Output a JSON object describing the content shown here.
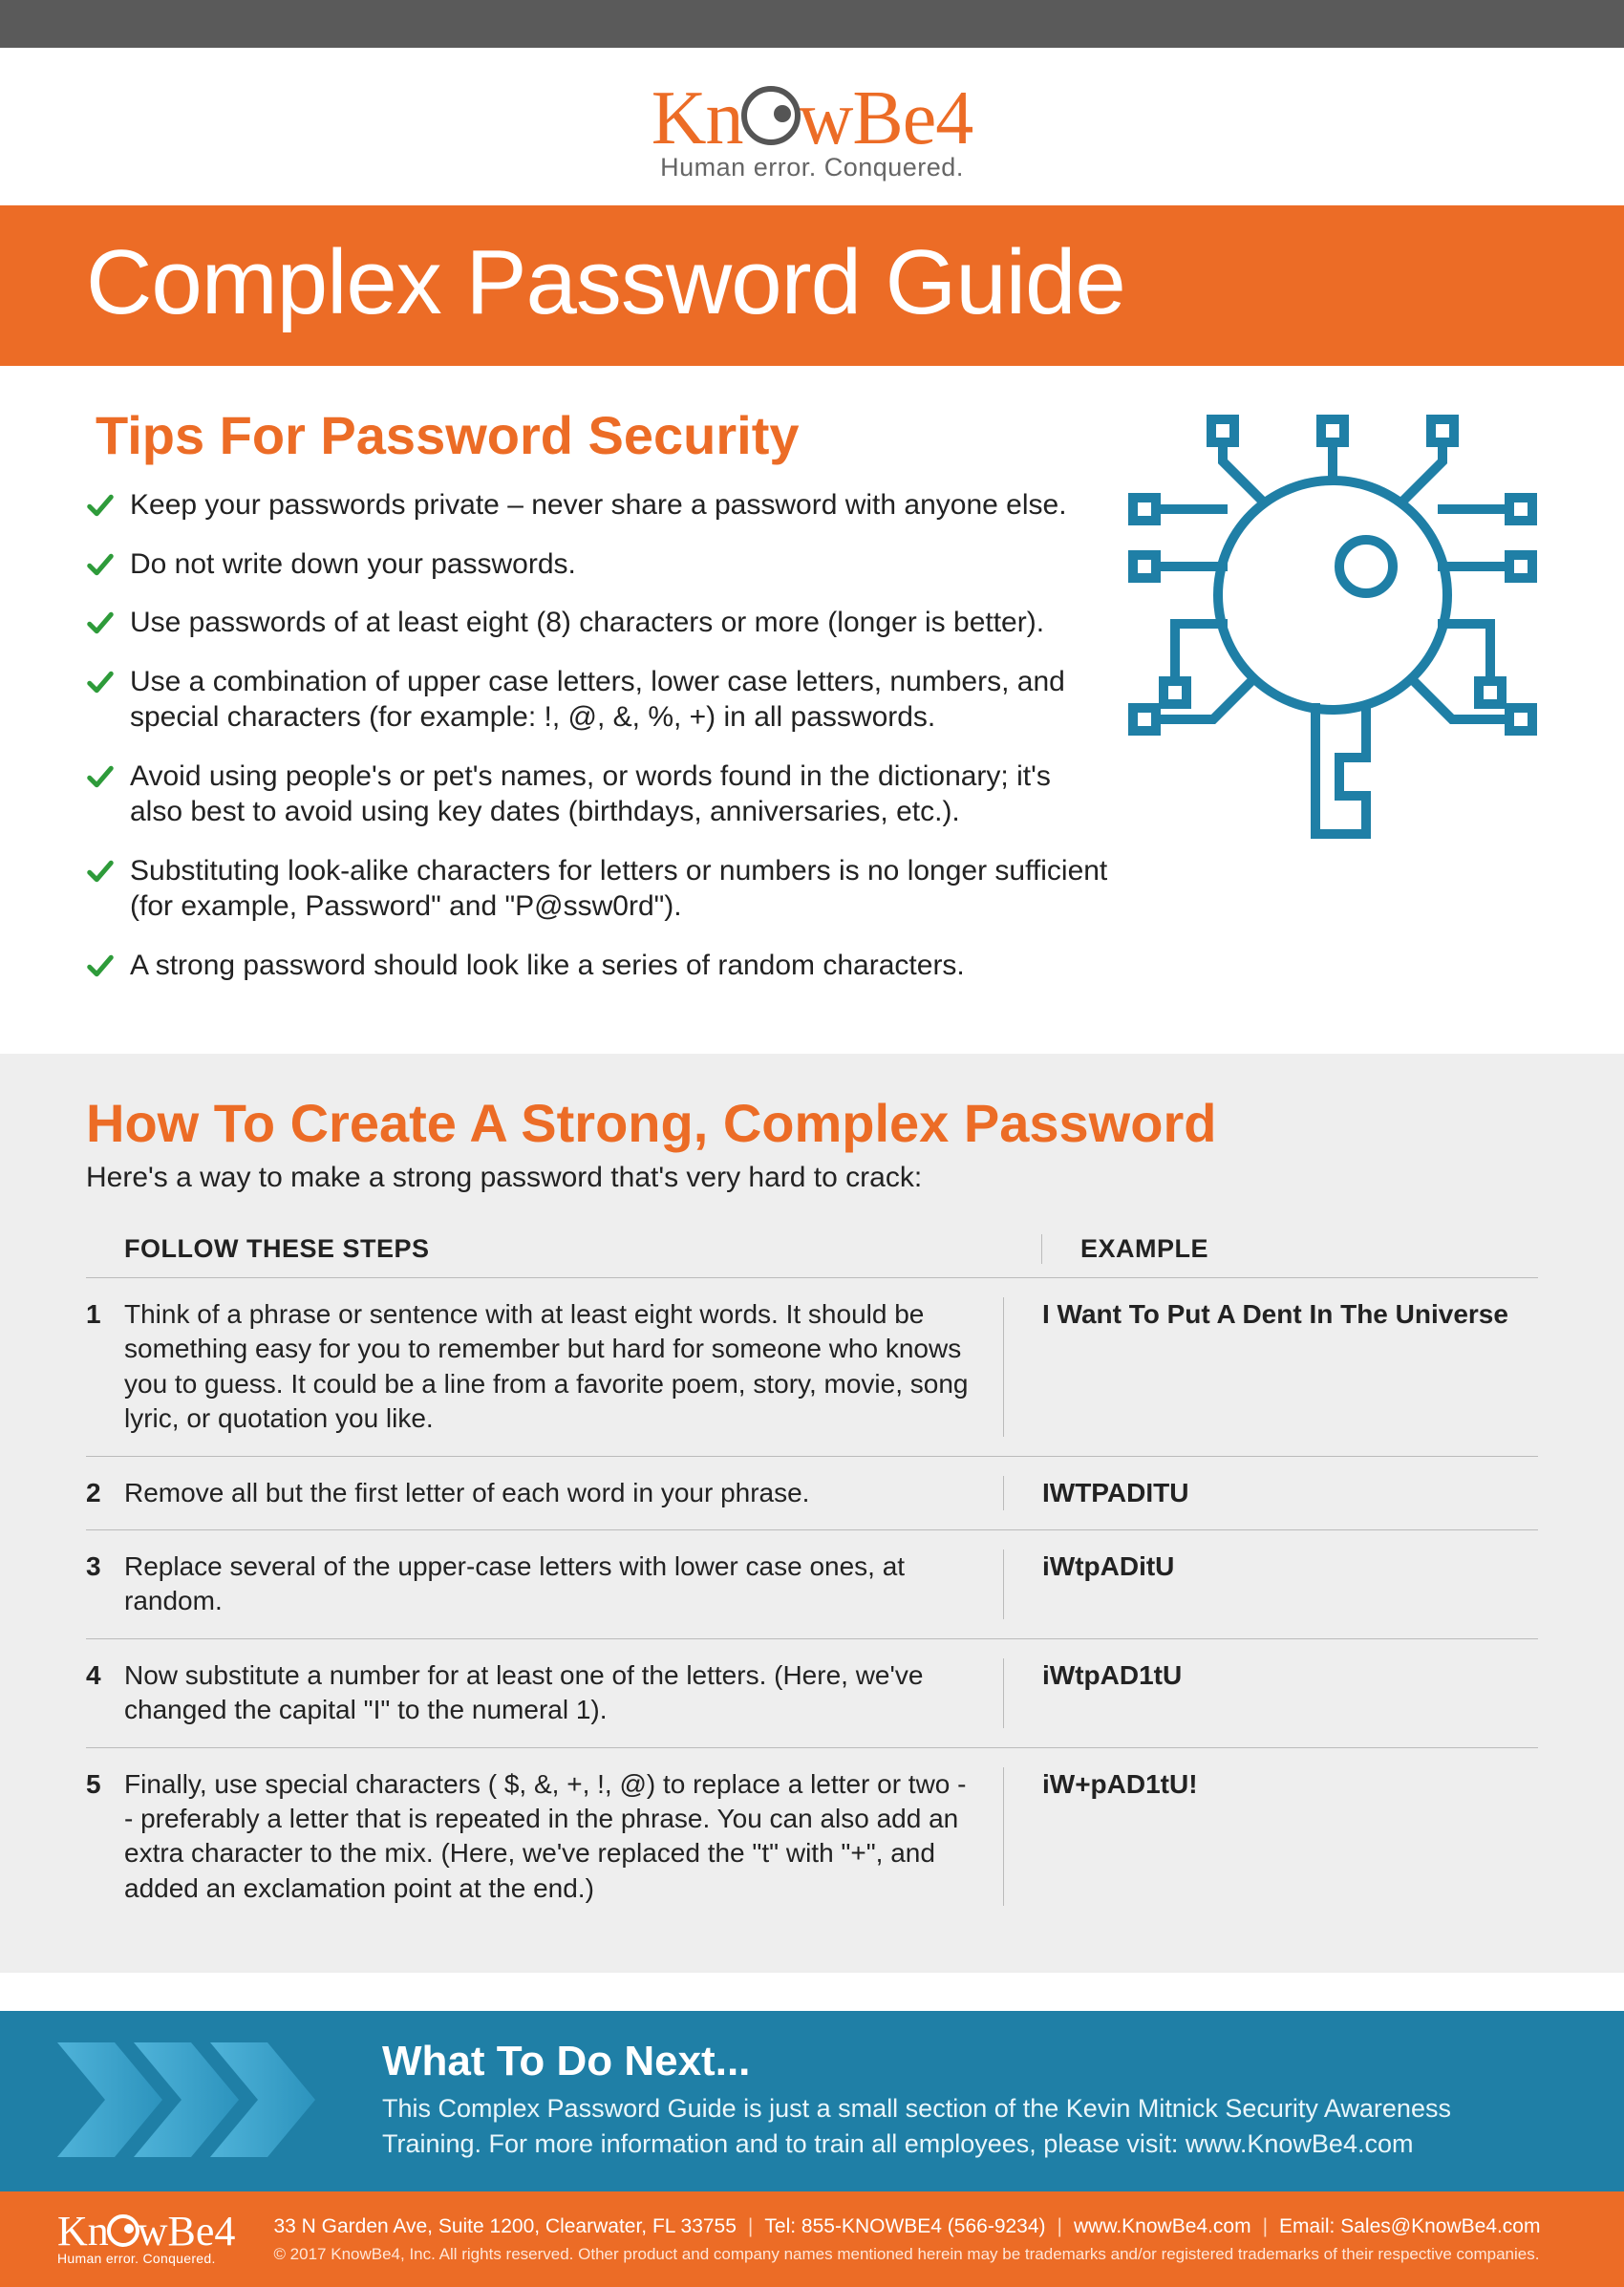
{
  "brand": {
    "name_part1": "Kn",
    "name_part2": "wBe4",
    "tagline": "Human error. Conquered."
  },
  "hero": {
    "title": "Complex Password Guide"
  },
  "tips": {
    "title": "Tips For Password Security",
    "items": [
      "Keep your passwords private – never share a password with anyone else.",
      "Do not write down your passwords.",
      "Use passwords of at least eight (8) characters or more (longer is better).",
      "Use a combination of upper case letters, lower case letters, numbers, and special characters (for example: !, @, &, %, +) in all passwords.",
      "Avoid using people's or pet's names, or words found in the dictionary; it's also best to avoid using key dates (birthdays, anniversaries, etc.).",
      "Substituting look-alike characters for letters or numbers is no longer sufficient (for example, Password\" and \"P@ssw0rd\").",
      "A strong password should look like a series of random characters."
    ]
  },
  "howto": {
    "title": "How To Create A Strong, Complex Password",
    "subtitle": "Here's a way to make a strong password that's very hard to crack:",
    "head_steps": "FOLLOW THESE STEPS",
    "head_example": "EXAMPLE",
    "steps": [
      {
        "n": "1",
        "text": "Think of a phrase or sentence with at least eight words. It should be something easy for you to remember but hard for someone who knows you to guess. It could be a line from a favorite poem, story, movie, song lyric, or quotation you like.",
        "example": "I Want To Put A Dent In The Universe"
      },
      {
        "n": "2",
        "text": "Remove all but the first letter of each word in your phrase.",
        "example": "IWTPADITU"
      },
      {
        "n": "3",
        "text": "Replace several of the upper-case letters with lower case ones, at random.",
        "example": "iWtpADitU"
      },
      {
        "n": "4",
        "text": "Now substitute a number for at least one of the letters. (Here, we've changed the capital \"I\" to the numeral 1).",
        "example": "iWtpAD1tU"
      },
      {
        "n": "5",
        "text": "Finally, use special characters ( $, &, +, !, @) to replace a letter or two -- preferably a letter that is repeated in the phrase. You can also add an extra character to the mix. (Here, we've replaced the \"t\" with \"+\", and added an exclamation point at the end.)",
        "example": "iW+pAD1tU!"
      }
    ]
  },
  "next": {
    "title": "What To Do Next...",
    "text": "This Complex Password Guide is just a small section of the Kevin Mitnick Security Awareness Training. For more information and to train all employees, please visit:  www.KnowBe4.com"
  },
  "footer": {
    "address": "33 N Garden Ave, Suite 1200, Clearwater, FL 33755",
    "tel": "Tel: 855-KNOWBE4 (566-9234)",
    "web": "www.KnowBe4.com",
    "email": "Email: Sales@KnowBe4.com",
    "copyright": "© 2017 KnowBe4, Inc.  All rights reserved.  Other product and company names mentioned herein may be trademarks and/or registered trademarks of their respective companies."
  }
}
